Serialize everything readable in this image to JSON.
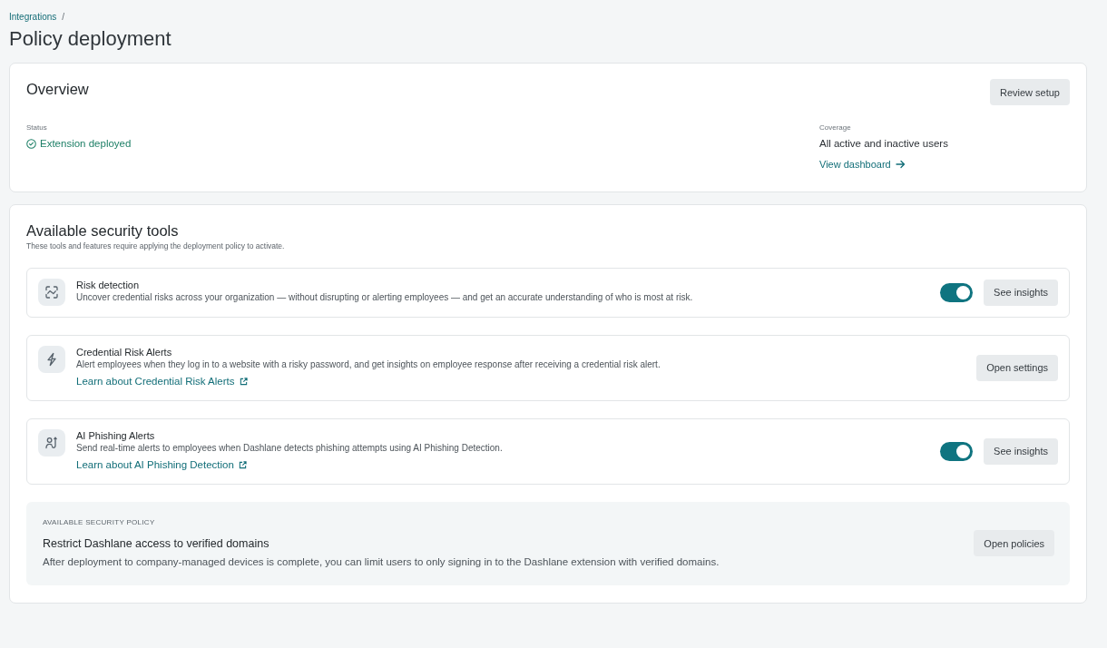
{
  "breadcrumb": {
    "items": [
      {
        "label": "Integrations"
      }
    ],
    "separator": "/"
  },
  "page_title": "Policy deployment",
  "overview": {
    "title": "Overview",
    "button": "Review setup",
    "status": {
      "label": "Status",
      "value": "Extension deployed"
    },
    "coverage": {
      "label": "Coverage",
      "value": "All active and inactive users",
      "link": "View dashboard"
    }
  },
  "security_tools": {
    "title": "Available security tools",
    "subtitle": "These tools and features require applying the deployment policy to activate.",
    "tools": [
      {
        "name": "Risk detection",
        "description": "Uncover credential risks across your organization — without disrupting or alerting employees — and get an accurate understanding of who is most at risk.",
        "toggle": {
          "on": true
        },
        "button": "See insights"
      },
      {
        "name": "Credential Risk Alerts",
        "description": "Alert employees when they log in to a website with a risky password, and get insights on employee response after receiving a credential risk alert.",
        "link": "Learn about Credential Risk Alerts",
        "button": "Open settings"
      },
      {
        "name": "AI Phishing Alerts",
        "description": "Send real-time alerts to employees when Dashlane detects phishing attempts using AI Phishing Detection.",
        "link": "Learn about AI Phishing Detection",
        "toggle": {
          "on": true
        },
        "button": "See insights"
      }
    ]
  },
  "policy": {
    "eyebrow": "AVAILABLE SECURITY POLICY",
    "title": "Restrict Dashlane access to verified domains",
    "description": "After deployment to company-managed devices is complete, you can limit users to only signing in to the Dashlane extension with verified domains.",
    "button": "Open policies"
  }
}
